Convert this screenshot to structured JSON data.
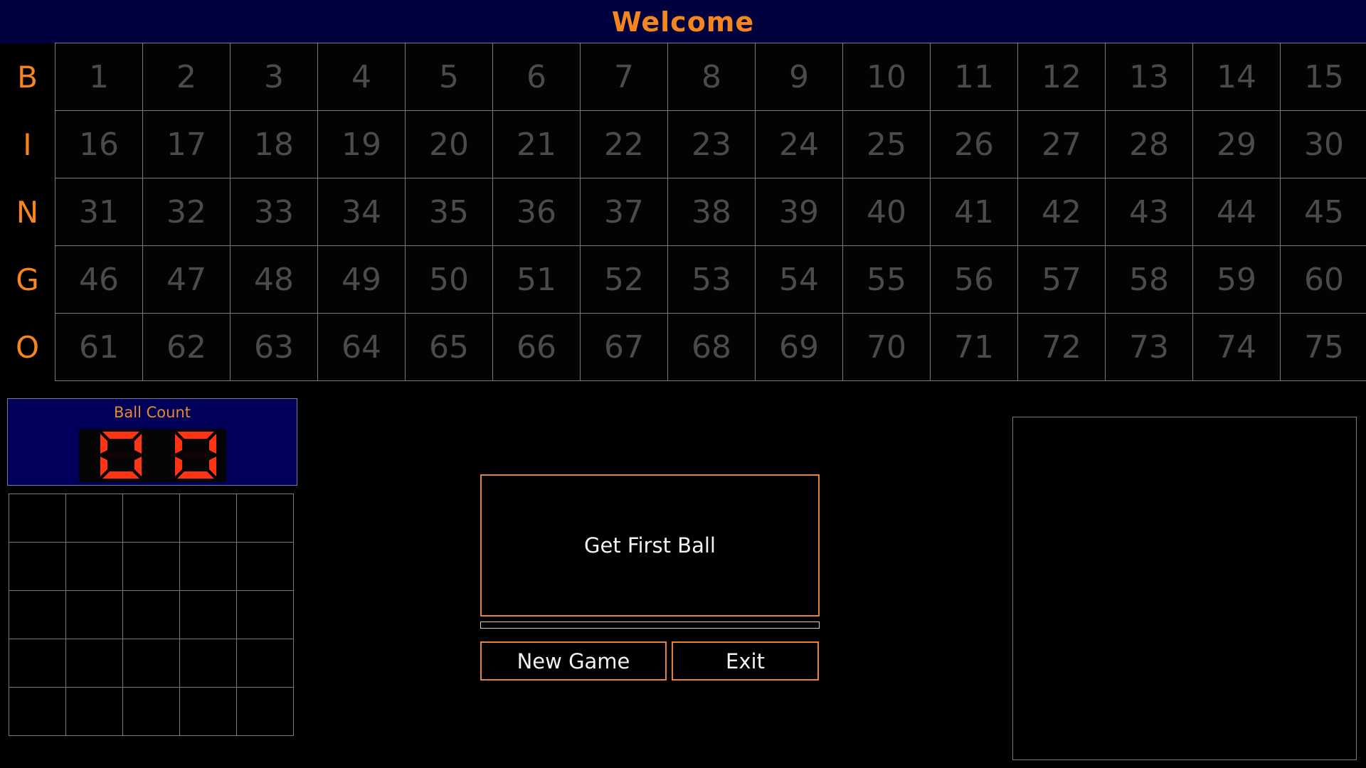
{
  "header": {
    "title": "Welcome"
  },
  "board": {
    "rows": [
      {
        "letter": "B",
        "numbers": [
          "1",
          "2",
          "3",
          "4",
          "5",
          "6",
          "7",
          "8",
          "9",
          "10",
          "11",
          "12",
          "13",
          "14",
          "15"
        ]
      },
      {
        "letter": "I",
        "numbers": [
          "16",
          "17",
          "18",
          "19",
          "20",
          "21",
          "22",
          "23",
          "24",
          "25",
          "26",
          "27",
          "28",
          "29",
          "30"
        ]
      },
      {
        "letter": "N",
        "numbers": [
          "31",
          "32",
          "33",
          "34",
          "35",
          "36",
          "37",
          "38",
          "39",
          "40",
          "41",
          "42",
          "43",
          "44",
          "45"
        ]
      },
      {
        "letter": "G",
        "numbers": [
          "46",
          "47",
          "48",
          "49",
          "50",
          "51",
          "52",
          "53",
          "54",
          "55",
          "56",
          "57",
          "58",
          "59",
          "60"
        ]
      },
      {
        "letter": "O",
        "numbers": [
          "61",
          "62",
          "63",
          "64",
          "65",
          "66",
          "67",
          "68",
          "69",
          "70",
          "71",
          "72",
          "73",
          "74",
          "75"
        ]
      }
    ]
  },
  "ball_count": {
    "label": "Ball Count",
    "value": "00"
  },
  "card": {
    "rows": 5,
    "cols": 5,
    "values": []
  },
  "controls": {
    "main_button": "Get First Ball",
    "new_game": "New Game",
    "exit": "Exit",
    "progress_percent": 0
  },
  "colors": {
    "accent": "#f5861f",
    "header_bg": "#00003f",
    "number_text": "#4b4b4b",
    "segment_on": "#ff3414"
  }
}
